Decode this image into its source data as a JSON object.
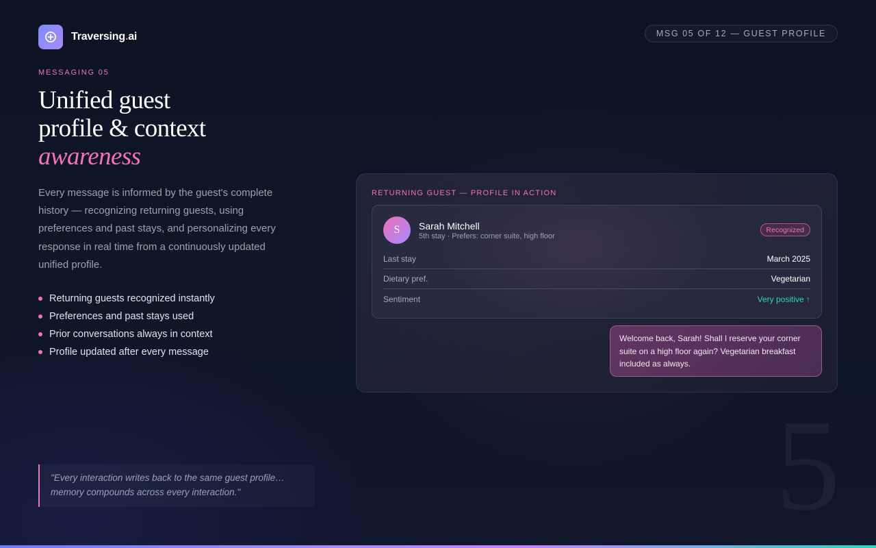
{
  "brand": {
    "name_main": "Traversing",
    "name_dot": ".",
    "name_suffix": "ai",
    "logo_icon": "plus-circle-icon"
  },
  "header": {
    "message_counter": "MSG 05 OF 12 — GUEST PROFILE"
  },
  "hero": {
    "eyebrow": "MESSAGING 05",
    "headline_line1": "Unified guest",
    "headline_line2": "profile & context",
    "headline_accent": "awareness",
    "body": "Every message is informed by the guest's complete history — recognizing returning guests, using preferences and past stays, and personalizing every response in real time from a continuously updated unified profile."
  },
  "features": [
    "Returning guests recognized instantly",
    "Preferences and past stays used",
    "Prior conversations always in context",
    "Profile updated after every message"
  ],
  "quote": "\"Every interaction writes back to the same guest profile… memory compounds across every interaction.\"",
  "panel": {
    "title": "RETURNING GUEST — PROFILE IN ACTION",
    "guest": {
      "initial": "S",
      "name": "Sarah Mitchell",
      "meta": "5th stay · Prefers: corner suite, high floor",
      "badge": "Recognized"
    },
    "rows": [
      {
        "label": "Last stay",
        "value": "March 2025"
      },
      {
        "label": "Dietary pref.",
        "value": "Vegetarian"
      },
      {
        "label": "Sentiment",
        "value": "Very positive ↑"
      }
    ],
    "reply": "Welcome back, Sarah! Shall I reserve your corner suite on a high floor again? Vegetarian breakfast included as always."
  },
  "slide_number": "5",
  "colors": {
    "accent_pink": "#f472b6",
    "accent_teal": "#2dd4bf",
    "background": "#0c1424"
  }
}
